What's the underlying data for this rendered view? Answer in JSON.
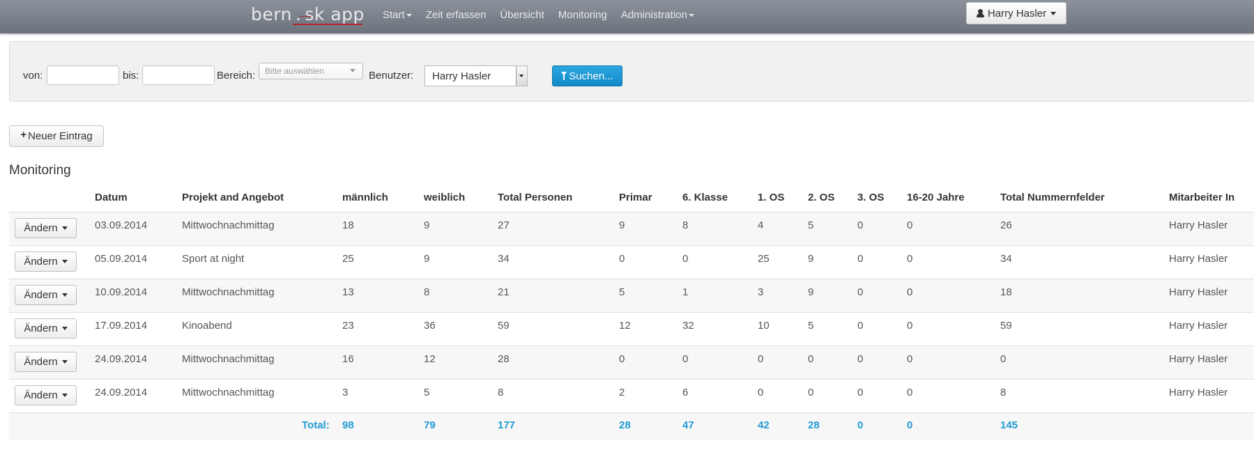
{
  "navbar": {
    "brand_left": "bern",
    "brand_sep": ".",
    "brand_right": "sk app",
    "items": [
      {
        "label": "Start",
        "dropdown": true
      },
      {
        "label": "Zeit erfassen",
        "dropdown": false
      },
      {
        "label": "Übersicht",
        "dropdown": false
      },
      {
        "label": "Monitoring",
        "dropdown": false
      },
      {
        "label": "Administration",
        "dropdown": true
      }
    ],
    "user": "Harry Hasler"
  },
  "filter": {
    "von_label": "von:",
    "von_value": "",
    "bis_label": "bis:",
    "bis_value": "",
    "bereich_label": "Bereich:",
    "bereich_placeholder": "Bitte auswählen",
    "benutzer_label": "Benutzer:",
    "benutzer_value": "Harry Hasler",
    "search_label": "Suchen..."
  },
  "new_entry_label": "Neuer Eintrag",
  "section_title": "Monitoring",
  "table": {
    "headers": [
      "Datum",
      "Projekt and Angebot",
      "männlich",
      "weiblich",
      "Total Personen",
      "Primar",
      "6. Klasse",
      "1. OS",
      "2. OS",
      "3. OS",
      "16-20 Jahre",
      "Total Nummernfelder",
      "Mitarbeiter In"
    ],
    "edit_label": "Ändern",
    "rows": [
      [
        "03.09.2014",
        "Mittwochnachmittag",
        "18",
        "9",
        "27",
        "9",
        "8",
        "4",
        "5",
        "0",
        "0",
        "26",
        "Harry Hasler"
      ],
      [
        "05.09.2014",
        "Sport at night",
        "25",
        "9",
        "34",
        "0",
        "0",
        "25",
        "9",
        "0",
        "0",
        "34",
        "Harry Hasler"
      ],
      [
        "10.09.2014",
        "Mittwochnachmittag",
        "13",
        "8",
        "21",
        "5",
        "1",
        "3",
        "9",
        "0",
        "0",
        "18",
        "Harry Hasler"
      ],
      [
        "17.09.2014",
        "Kinoabend",
        "23",
        "36",
        "59",
        "12",
        "32",
        "10",
        "5",
        "0",
        "0",
        "59",
        "Harry Hasler"
      ],
      [
        "24.09.2014",
        "Mittwochnachmittag",
        "16",
        "12",
        "28",
        "0",
        "0",
        "0",
        "0",
        "0",
        "0",
        "0",
        "Harry Hasler"
      ],
      [
        "24.09.2014",
        "Mittwochnachmittag",
        "3",
        "5",
        "8",
        "2",
        "6",
        "0",
        "0",
        "0",
        "0",
        "8",
        "Harry Hasler"
      ]
    ],
    "total_label": "Total:",
    "totals": [
      "98",
      "79",
      "177",
      "28",
      "47",
      "42",
      "28",
      "0",
      "0",
      "145"
    ]
  },
  "colors": {
    "navbar_top": "#8c929b",
    "navbar_bottom": "#6c727c",
    "accent_blue": "#1f9ad2",
    "search_button": "#1b98d5",
    "brand_underline": "#b3262c"
  },
  "icons": {
    "user": "user-icon",
    "filter": "funnel-icon",
    "add": "plus-icon"
  }
}
